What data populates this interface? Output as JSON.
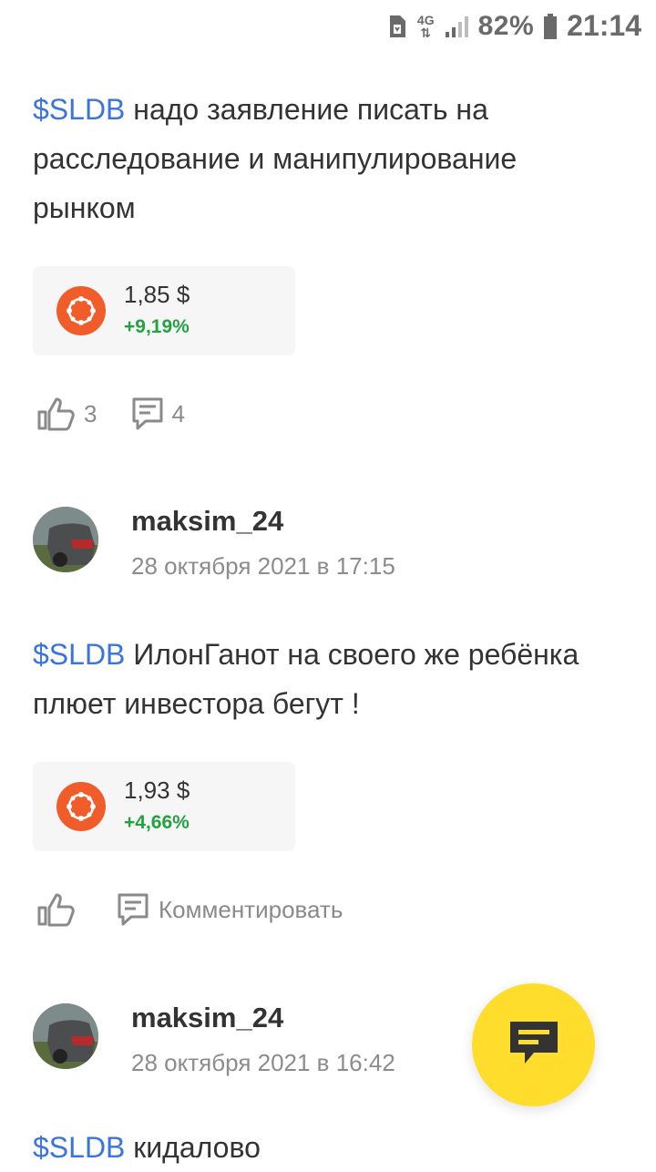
{
  "status_bar": {
    "network": "4G",
    "battery": "82%",
    "time": "21:14"
  },
  "posts": [
    {
      "ticker": "$SLDB",
      "text": " надо заявление писать на расследование и манипулирование рынком",
      "quote": {
        "price": "1,85 $",
        "change": "+9,19%"
      },
      "likes": "3",
      "comments": "4"
    },
    {
      "author": {
        "name": "maksim_24",
        "date": "28 октября 2021 в 17:15"
      },
      "ticker": "$SLDB",
      "text": " ИлонГанот  на своего же ребёнка плюет инвестора бегут !",
      "quote": {
        "price": "1,93 $",
        "change": "+4,66%"
      },
      "comment_label": "Комментировать"
    },
    {
      "author": {
        "name": "maksim_24",
        "date": "28 октября 2021 в 16:42"
      },
      "ticker": "$SLDB",
      "text": " кидалово"
    }
  ],
  "colors": {
    "ticker": "#3b74e0",
    "positive": "#22a340",
    "fab": "#ffdd2d",
    "logo": "#f05d2a"
  },
  "icons": [
    "sim-icon",
    "signal-icon",
    "battery-icon",
    "like-icon",
    "comment-icon",
    "quote-logo-icon",
    "chat-fab-icon"
  ]
}
